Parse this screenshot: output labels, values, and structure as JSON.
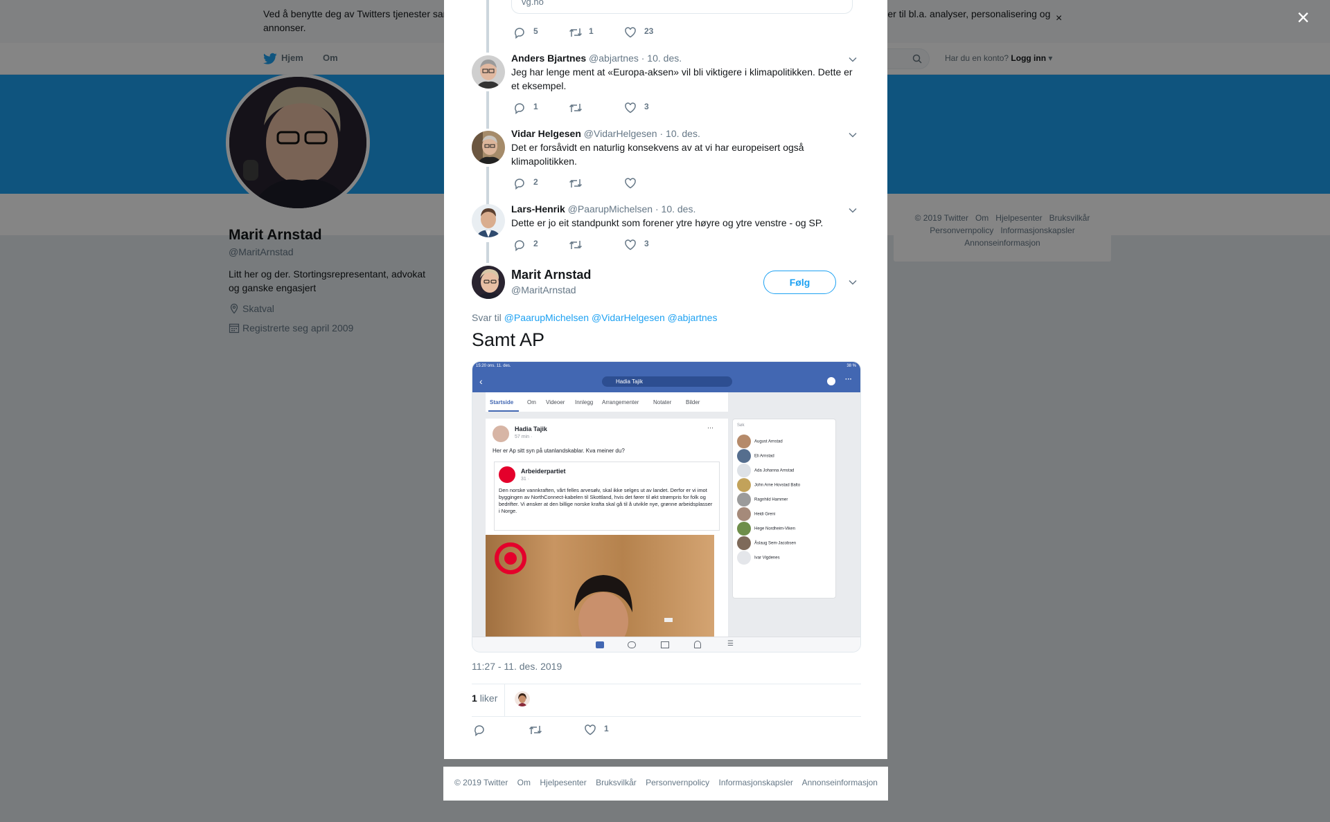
{
  "background": {
    "cookie_text": "Ved å benytte deg av Twitters tjenester samtykker du til vår bruk av informasjonskapsler. Vi og våre samarbeidspartnere bruker informasjonskapsler til bl.a. analyser, personalisering og annonser.",
    "cookie_close": "×",
    "nav": {
      "home": "Hjem",
      "about": "Om",
      "account_prompt": "Har du en konto?",
      "login": "Logg inn"
    },
    "profile": {
      "name": "Marit Arnstad",
      "handle": "@MaritArnstad",
      "bio": "Litt her og der. Stortingsrepresentant, advokat og ganske engasjert",
      "location": "Skatval",
      "joined": "Registrerte seg april 2009"
    },
    "side_footer": [
      "© 2019 Twitter",
      "Om",
      "Hjelpesenter",
      "Bruksvilkår",
      "Personvernpolicy",
      "Informasjonskapsler",
      "Annonseinformasjon"
    ]
  },
  "modal_close": "×",
  "thread": {
    "link_card_domain": "vg.no",
    "first_actions": {
      "replies": "5",
      "retweets": "1",
      "likes": "23"
    },
    "replies": [
      {
        "name": "Anders Bjartnes",
        "handle": "@abjartnes",
        "date": "· 10. des.",
        "text": "Jeg har lenge ment at «Europa-aksen» vil bli viktigere i klimapolitikken. Dette er et eksempel.",
        "replies": "1",
        "retweets": "",
        "likes": "3"
      },
      {
        "name": "Vidar Helgesen",
        "handle": "@VidarHelgesen",
        "date": "· 10. des.",
        "text": "Det er forsåvidt en naturlig konsekvens av at vi har europeisert også klimapolitikken.",
        "replies": "2",
        "retweets": "",
        "likes": ""
      },
      {
        "name": "Lars-Henrik",
        "handle": "@PaarupMichelsen",
        "date": "· 10. des.",
        "text": "Dette er jo eit standpunkt som forener ytre høyre og ytre venstre - og SP.",
        "replies": "2",
        "retweets": "",
        "likes": "3"
      }
    ]
  },
  "main_tweet": {
    "name": "Marit Arnstad",
    "handle": "@MaritArnstad",
    "follow_label": "Følg",
    "reply_prefix": "Svar til",
    "reply_mentions": [
      "@PaarupMichelsen",
      "@VidarHelgesen",
      "@abjartnes"
    ],
    "text": "Samt AP",
    "timestamp": "11:27 - 11. des. 2019",
    "likes_count": "1",
    "likes_label": "liker",
    "action_likes": "1"
  },
  "media": {
    "status_time": "15:20  ons. 11. des.",
    "status_right": "38 %",
    "search_value": "Hadia Tajik",
    "tabs": [
      "Startside",
      "Om",
      "Videoer",
      "Innlegg",
      "Arrangementer",
      "Notater",
      "Bilder"
    ],
    "post_author": "Hadia Tajik",
    "post_time": "57 min · ",
    "post_text": "Her er Ap sitt syn på utanlandskablar. Kva meiner du?",
    "quoted_author": "Arbeiderpartiet",
    "quoted_time": "31 · ",
    "quoted_text": "Den norske vannkraften, vårt felles arvesølv, skal ikke selges ut av landet. Derfor er vi imot byggingen av NorthConnect-kabelen til Skottland, hvis det fører til økt strømpris for folk og bedrifter. Vi ønsker at den billige norske krafta skal gå til å utvikle nye, grønne arbeidsplasser i Norge.",
    "friends_search": "Søk",
    "friends": [
      "August Arnstad",
      "Eli Arnstad",
      "Ada Johanna Arnstad",
      "John Arne Hovstad Balto",
      "Ragnhild Hammer",
      "Heidi Greni",
      "Hege Nordheim-Viken",
      "Åslaug Sem-Jacobsen",
      "Ivar Vigdenes"
    ]
  },
  "bottom_footer": [
    "© 2019 Twitter",
    "Om",
    "Hjelpesenter",
    "Bruksvilkår",
    "Personvernpolicy",
    "Informasjonskapsler",
    "Annonseinformasjon"
  ],
  "colors": {
    "twitter_blue": "#1da1f2",
    "text_dark": "#14171a",
    "text_muted": "#657786",
    "thread_line": "#ccd6dd",
    "facebook_blue": "#4267b2"
  }
}
